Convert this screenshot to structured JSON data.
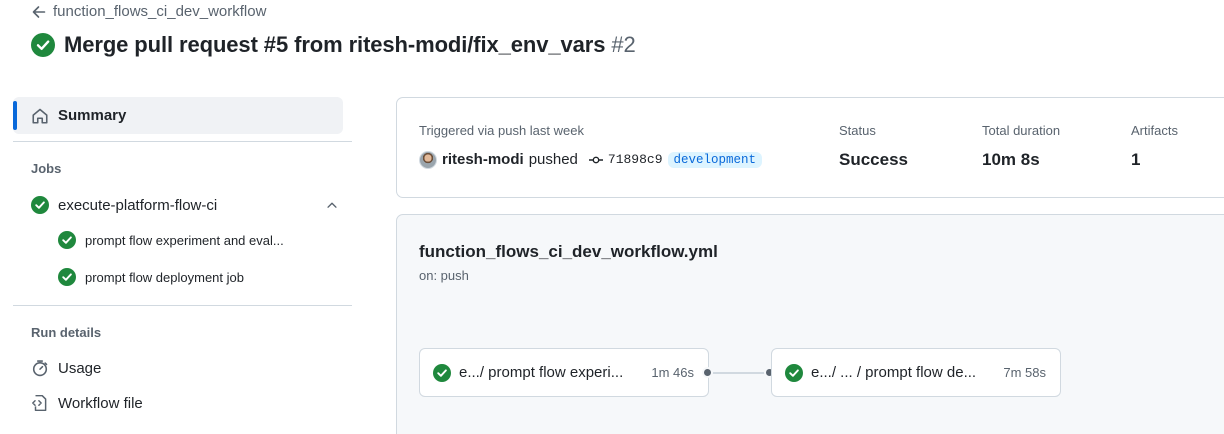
{
  "header": {
    "back_label": "function_flows_ci_dev_workflow",
    "title": "Merge pull request #5 from ritesh-modi/fix_env_vars",
    "run_number": "#2"
  },
  "sidebar": {
    "summary_label": "Summary",
    "jobs_heading": "Jobs",
    "job_group": {
      "label": "execute-platform-flow-ci",
      "status": "success"
    },
    "sub_jobs": [
      {
        "label": "prompt flow experiment and eval...",
        "status": "success"
      },
      {
        "label": "prompt flow deployment job",
        "status": "success"
      }
    ],
    "run_details_heading": "Run details",
    "usage_label": "Usage",
    "workflow_file_label": "Workflow file"
  },
  "summary": {
    "trigger_label": "Triggered via push last week",
    "actor": "ritesh-modi",
    "action": "pushed",
    "commit_sha": "71898c9",
    "branch": "development",
    "status_label": "Status",
    "status_value": "Success",
    "duration_label": "Total duration",
    "duration_value": "10m 8s",
    "artifacts_label": "Artifacts",
    "artifacts_value": "1"
  },
  "workflow": {
    "file": "function_flows_ci_dev_workflow.yml",
    "on": "on: push",
    "jobs": [
      {
        "name": "e.../ prompt flow experi...",
        "time": "1m 46s",
        "status": "success"
      },
      {
        "name": "e.../ ... / prompt flow de...",
        "time": "7m 58s",
        "status": "success"
      }
    ]
  },
  "colors": {
    "success": "#1f883d",
    "accent": "#0969da",
    "muted": "#59636e",
    "border": "#d1d9e0"
  }
}
